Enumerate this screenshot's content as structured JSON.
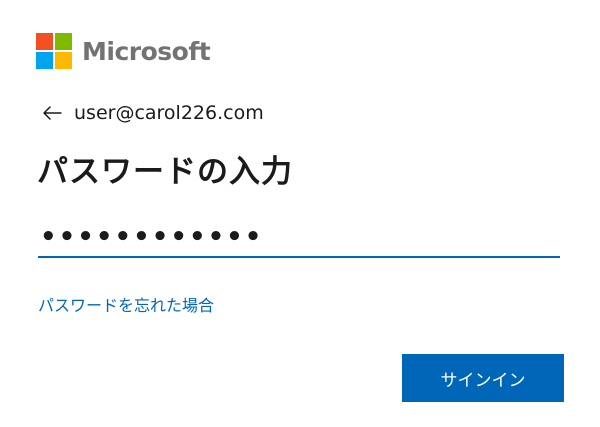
{
  "brand": {
    "name": "Microsoft",
    "logo_colors": [
      "#f25022",
      "#7fba00",
      "#00a4ef",
      "#ffb900"
    ]
  },
  "identity": {
    "back_icon": "arrow-left-icon",
    "email": "user@carol226.com"
  },
  "title": "パスワードの入力",
  "password": {
    "masked_value": "••••••••••••"
  },
  "forgot_password": {
    "label": "パスワードを忘れた場合"
  },
  "signin_button": {
    "label": "サインイン"
  },
  "colors": {
    "accent": "#0067b8",
    "text": "#1b1b1b",
    "brand_gray": "#737373"
  }
}
